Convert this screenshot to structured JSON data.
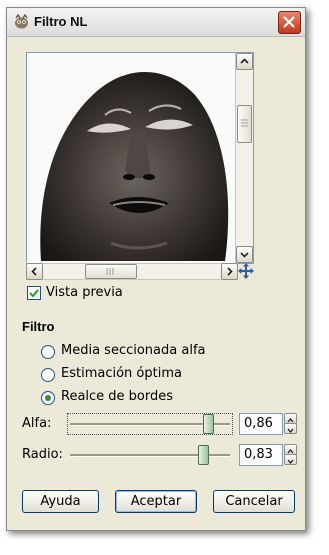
{
  "window": {
    "title": "Filtro NL",
    "title_icon": "gimp-icon"
  },
  "preview": {
    "image": "statue-face-closeup",
    "checkbox_label": "Vista previa",
    "checked": true
  },
  "filter": {
    "title": "Filtro",
    "options": [
      {
        "label": "Media seccionada alfa",
        "selected": false
      },
      {
        "label": "Estimación óptima",
        "selected": false
      },
      {
        "label": "Realce de bordes",
        "selected": true
      }
    ]
  },
  "alpha": {
    "label": "Alfa:",
    "value": "0,86",
    "fraction": 0.86
  },
  "radius": {
    "label": "Radio:",
    "value": "0,83",
    "fraction": 0.83
  },
  "buttons": {
    "help": "Ayuda",
    "accept": "Aceptar",
    "cancel": "Cancelar"
  },
  "colors": {
    "dialog_bg": "#ece9d8",
    "close": "#c2381f",
    "radio_fill": "#3a8a3a"
  }
}
